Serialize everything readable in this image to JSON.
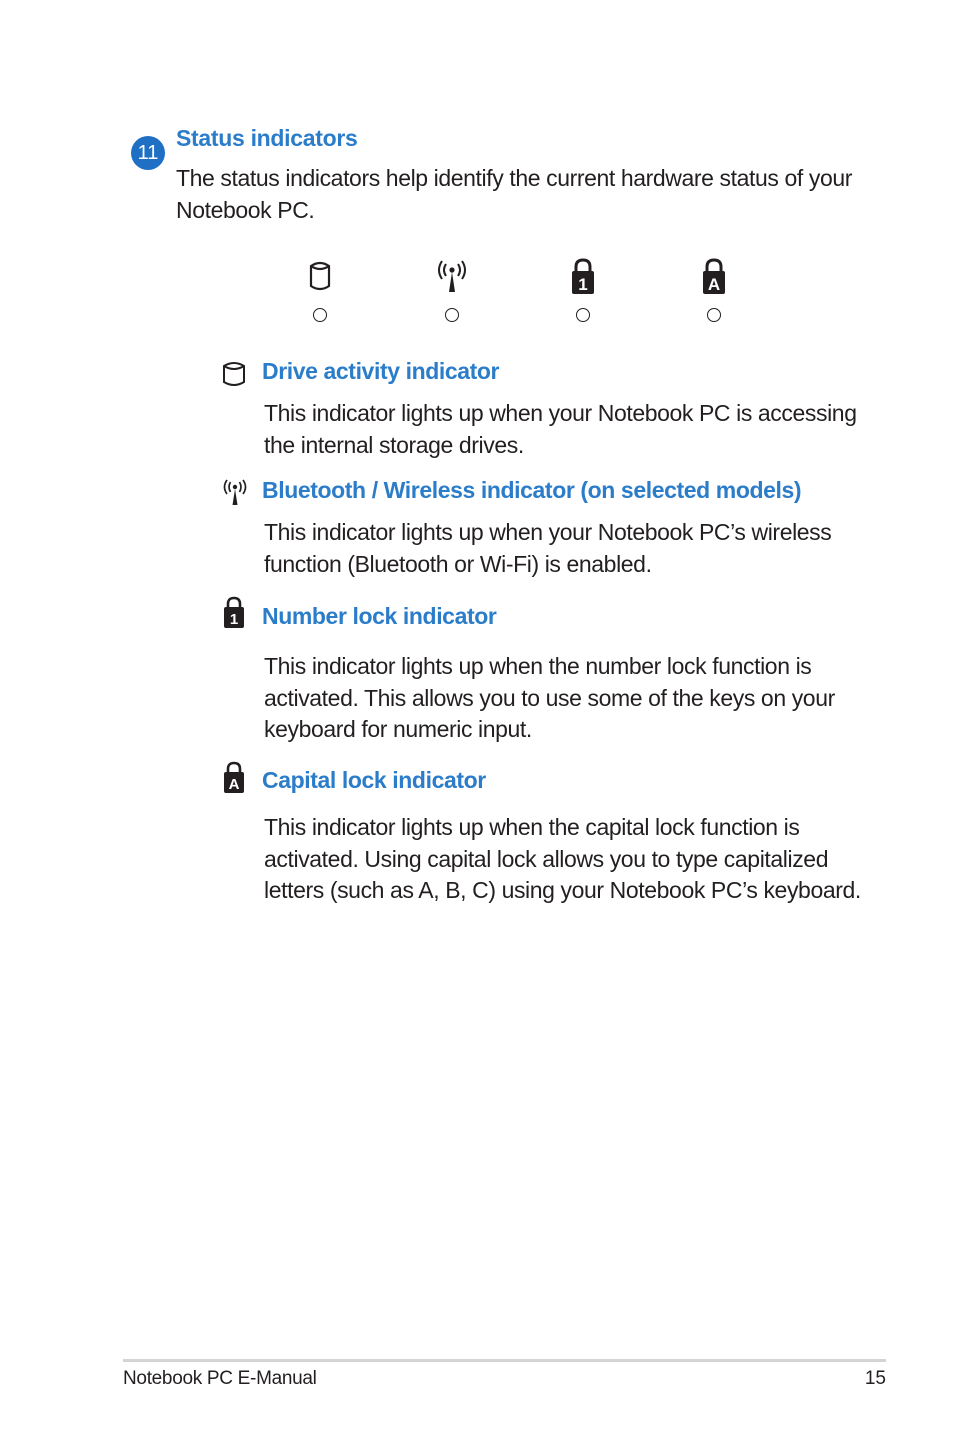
{
  "section": {
    "number": "11",
    "title": "Status indicators",
    "intro": "The status indicators help identify the current hardware status of your Notebook PC."
  },
  "indicator_row": [
    {
      "icon": "drive-icon"
    },
    {
      "icon": "wireless-icon"
    },
    {
      "icon": "number-lock-icon",
      "glyph": "1"
    },
    {
      "icon": "capital-lock-icon",
      "glyph": "A"
    }
  ],
  "items": [
    {
      "icon": "drive-icon",
      "title": "Drive activity indicator",
      "body": "This indicator lights up when your Notebook PC is accessing the internal storage drives."
    },
    {
      "icon": "wireless-icon",
      "title": "Bluetooth / Wireless indicator (on selected models)",
      "body": "This indicator lights up when your Notebook PC’s wireless function (Bluetooth or Wi-Fi) is enabled."
    },
    {
      "icon": "number-lock-icon",
      "glyph": "1",
      "title": "Number lock indicator",
      "body": "This indicator lights up when the number lock function is activated. This allows you to use some of the keys on your keyboard for numeric input."
    },
    {
      "icon": "capital-lock-icon",
      "glyph": "A",
      "title": "Capital lock indicator",
      "body": "This indicator lights up when the capital lock function is activated. Using capital lock allows you to type capitalized letters (such as A, B, C) using your Notebook PC’s keyboard."
    }
  ],
  "footer": {
    "title": "Notebook PC E-Manual",
    "page_number": "15"
  },
  "colors": {
    "accent": "#2b7cc9",
    "badge": "#1f6fc5",
    "text": "#231f20"
  }
}
